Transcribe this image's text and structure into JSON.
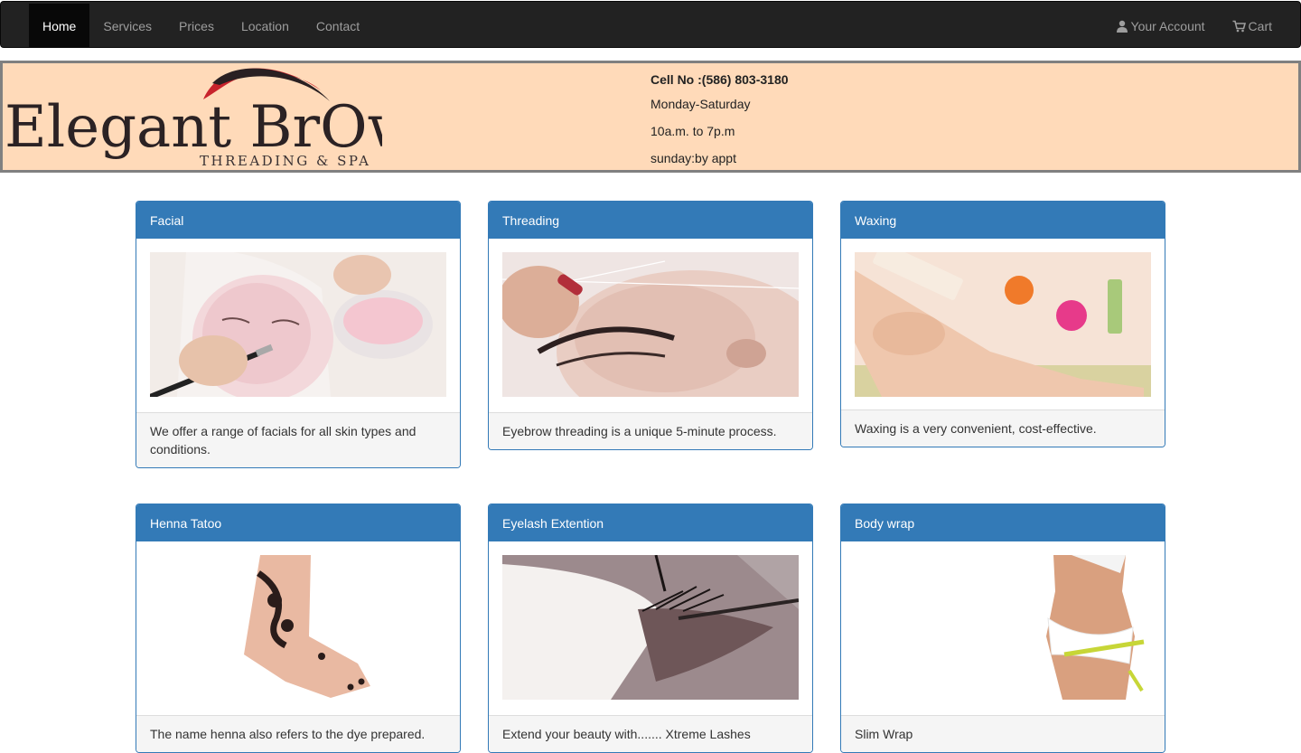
{
  "nav": {
    "left": [
      {
        "label": "Home",
        "active": true
      },
      {
        "label": "Services"
      },
      {
        "label": "Prices"
      },
      {
        "label": "Location"
      },
      {
        "label": "Contact"
      }
    ],
    "account_label": "Your Account",
    "account_icon": "user-icon",
    "cart_label": "Cart",
    "cart_icon": "cart-icon"
  },
  "banner": {
    "logo_text": "Elegant BrOws",
    "logo_subtext": "THREADING & SPA",
    "phone": "Cell No :(586) 803-3180",
    "days": "Monday-Saturday",
    "hours": "10a.m. to 7p.m",
    "sunday": "sunday:by appt",
    "background_color": "#ffdab9"
  },
  "services": [
    {
      "title": "Facial",
      "description": "We offer a range of facials for all skin types and conditions."
    },
    {
      "title": "Threading",
      "description": "Eyebrow threading is a unique 5-minute process."
    },
    {
      "title": "Waxing",
      "description": "Waxing is a very convenient, cost-effective."
    },
    {
      "title": "Henna Tatoo",
      "description": "The name henna also refers to the dye prepared."
    },
    {
      "title": "Eyelash Extention",
      "description": "Extend your beauty with....... Xtreme Lashes"
    },
    {
      "title": "Body wrap",
      "description": "Slim Wrap"
    }
  ],
  "colors": {
    "navbar": "#222222",
    "panel_primary": "#337ab7"
  }
}
